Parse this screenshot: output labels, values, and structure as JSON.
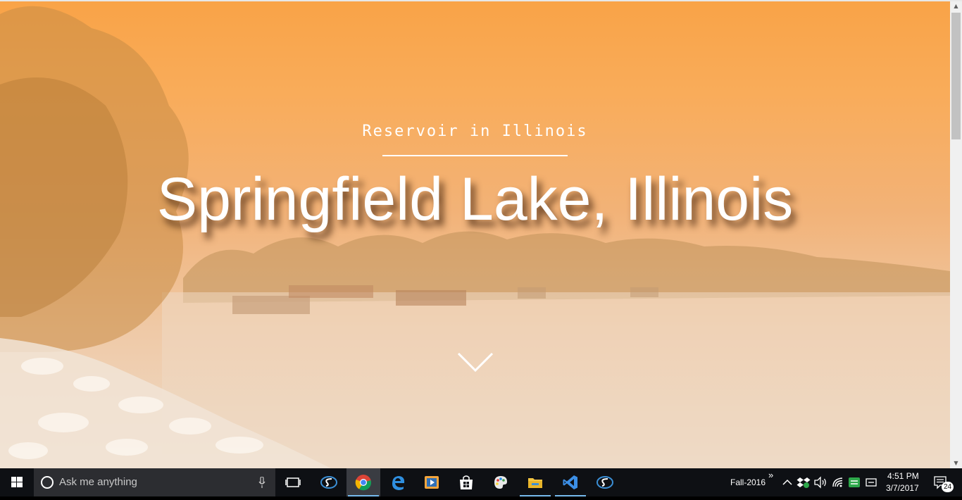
{
  "hero": {
    "subtitle": "Reservoir in Illinois",
    "title": "Springfield Lake, Illinois"
  },
  "taskbar": {
    "search_placeholder": "Ask me anything",
    "apps": [
      {
        "name": "task-view-icon"
      },
      {
        "name": "sharepoint-designer-icon"
      },
      {
        "name": "chrome-icon"
      },
      {
        "name": "edge-icon"
      },
      {
        "name": "media-player-icon"
      },
      {
        "name": "store-icon"
      },
      {
        "name": "paint-icon"
      },
      {
        "name": "file-explorer-icon"
      },
      {
        "name": "visual-studio-icon"
      },
      {
        "name": "sharepoint-designer-icon-2"
      }
    ],
    "toolbar_label": "Fall-2016",
    "toolbar_chevron": "»",
    "time": "4:51 PM",
    "date": "3/7/2017",
    "notifications_count": "24"
  },
  "colors": {
    "sky_top": "#f9a347",
    "water": "#eedcca",
    "taskbar": "#0e1014",
    "search_box": "#2c2d31",
    "accent": "#76b9ed"
  }
}
